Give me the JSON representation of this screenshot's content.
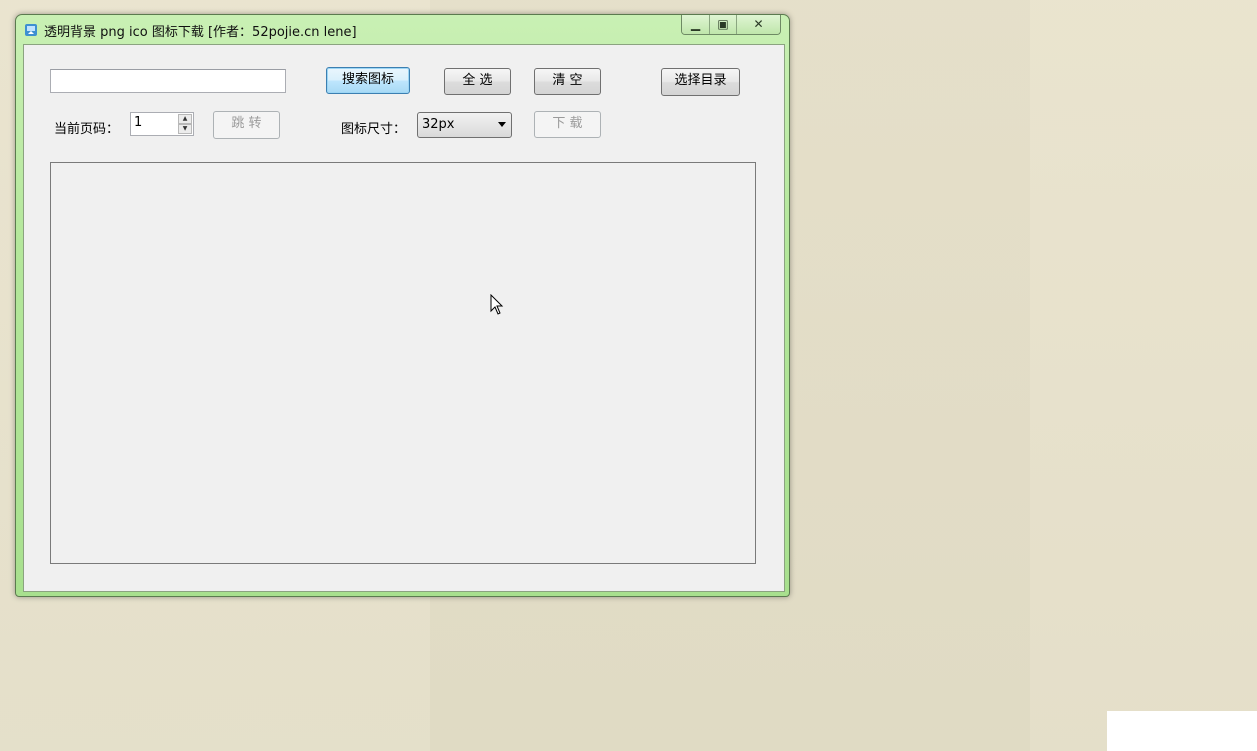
{
  "window": {
    "title": "透明背景 png ico 图标下载  [作者：52pojie.cn lene]",
    "caption_buttons": [
      "minimize",
      "maximize",
      "close"
    ]
  },
  "toolbar": {
    "search_input_value": "",
    "search_label": "搜索图标",
    "select_all_label": "全 选",
    "clear_label": "清 空",
    "choose_dir_label": "选择目录"
  },
  "paging": {
    "current_page_label": "当前页码：",
    "current_page_value": "1",
    "jump_label": "跳 转"
  },
  "size": {
    "label": "图标尺寸：",
    "selected": "32px",
    "download_label": "下 载"
  },
  "colors": {
    "frame": "#b4e79b",
    "client": "#f0f0f0",
    "desktop": "#e8e2cb",
    "focus": "#3c7fb1"
  },
  "icons": {
    "app": "app-logo-icon",
    "cursor": "mouse-pointer-icon"
  }
}
